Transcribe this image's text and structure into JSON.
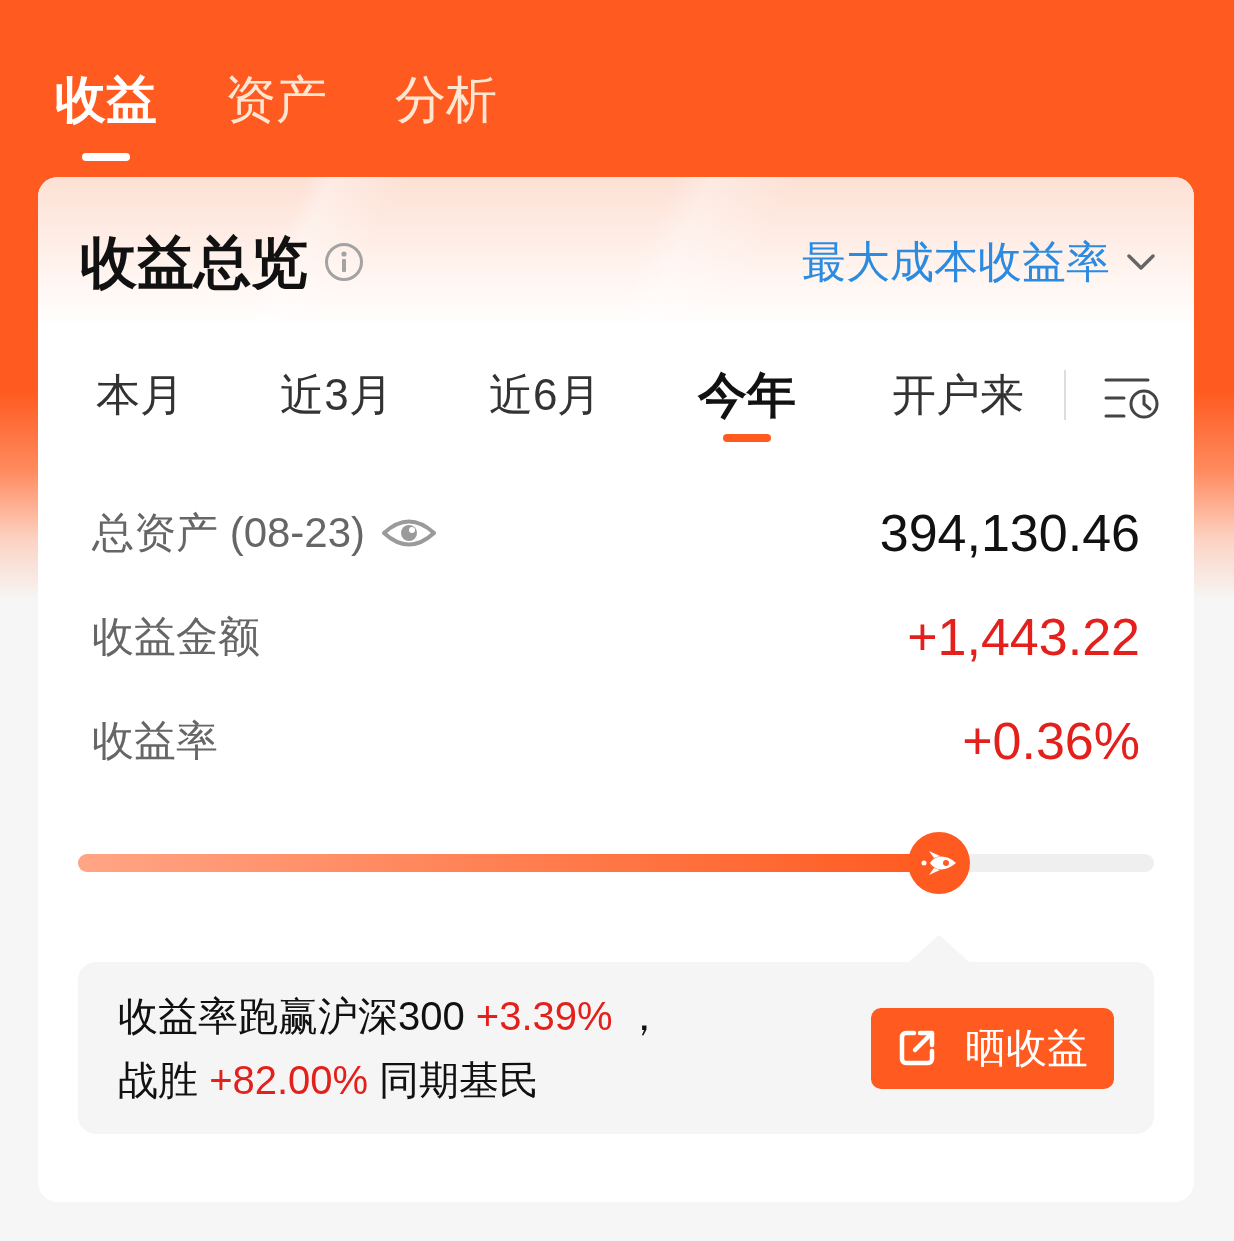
{
  "top_tabs": [
    {
      "label": "收益",
      "selected": true
    },
    {
      "label": "资产",
      "selected": false
    },
    {
      "label": "分析",
      "selected": false
    }
  ],
  "card": {
    "title": "收益总览",
    "metric_selector": {
      "label": "最大成本收益率"
    },
    "period_tabs": [
      {
        "label": "本月",
        "selected": false
      },
      {
        "label": "近3月",
        "selected": false
      },
      {
        "label": "近6月",
        "selected": false
      },
      {
        "label": "今年",
        "selected": true
      },
      {
        "label": "开户来",
        "selected": false
      }
    ],
    "rows": [
      {
        "kind": "total",
        "label": "总资产 (08-23)",
        "value": "394,130.46"
      },
      {
        "kind": "gain",
        "label": "收益金额",
        "value": "+1,443.22"
      },
      {
        "kind": "gain",
        "label": "收益率",
        "value": "+0.36%"
      }
    ],
    "progress": {
      "level": 0.8
    },
    "summary": {
      "lines": [
        [
          {
            "kind": "plain",
            "text": "收益率跑赢沪深300 "
          },
          {
            "kind": "gain",
            "text": "+3.39%"
          },
          {
            "kind": "plain",
            "text": " ，"
          }
        ],
        [
          {
            "kind": "plain",
            "text": "战胜 "
          },
          {
            "kind": "gain",
            "text": "+82.00%"
          },
          {
            "kind": "plain",
            "text": " 同期基民"
          }
        ]
      ]
    },
    "share_button": {
      "label": "晒收益"
    }
  }
}
